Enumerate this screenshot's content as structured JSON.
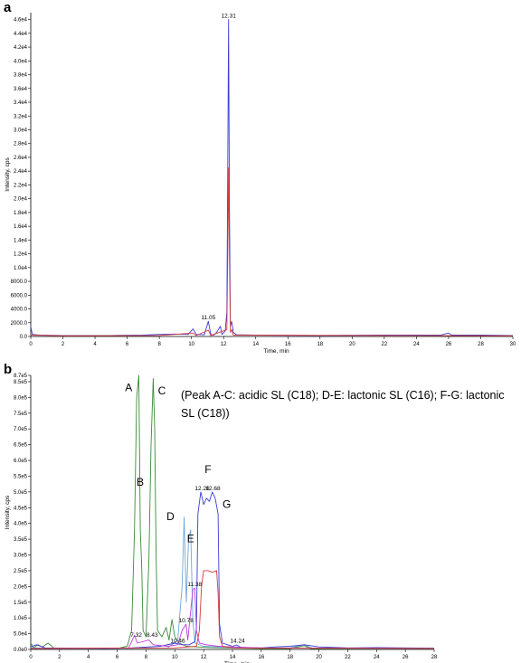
{
  "chart_data": [
    {
      "panel": "a",
      "type": "line",
      "xlabel": "Time, min",
      "ylabel": "Intensity, cps",
      "xlim": [
        0,
        30
      ],
      "ylim": [
        0,
        47000
      ],
      "x_ticks": [
        "0",
        "2",
        "4",
        "6",
        "8",
        "10",
        "12",
        "14",
        "16",
        "18",
        "20",
        "22",
        "24",
        "26",
        "28",
        "30"
      ],
      "y_ticks": [
        {
          "v": 0,
          "t": "0.0"
        },
        {
          "v": 2000,
          "t": "2000.0"
        },
        {
          "v": 4000,
          "t": "4000.0"
        },
        {
          "v": 6000,
          "t": "6000.0"
        },
        {
          "v": 8000,
          "t": "8000.0"
        },
        {
          "v": 10000,
          "t": "1.0e4"
        },
        {
          "v": 12000,
          "t": "1.2e4"
        },
        {
          "v": 14000,
          "t": "1.4e4"
        },
        {
          "v": 16000,
          "t": "1.6e4"
        },
        {
          "v": 18000,
          "t": "1.8e4"
        },
        {
          "v": 20000,
          "t": "2.0e4"
        },
        {
          "v": 22000,
          "t": "2.2e4"
        },
        {
          "v": 24000,
          "t": "2.4e4"
        },
        {
          "v": 26000,
          "t": "2.6e4"
        },
        {
          "v": 28000,
          "t": "2.8e4"
        },
        {
          "v": 30000,
          "t": "3.0e4"
        },
        {
          "v": 32000,
          "t": "3.2e4"
        },
        {
          "v": 34000,
          "t": "3.4e4"
        },
        {
          "v": 36000,
          "t": "3.6e4"
        },
        {
          "v": 38000,
          "t": "3.8e4"
        },
        {
          "v": 40000,
          "t": "4.0e4"
        },
        {
          "v": 42000,
          "t": "4.2e4"
        },
        {
          "v": 44000,
          "t": "4.4e4"
        },
        {
          "v": 46000,
          "t": "4.6e4"
        }
      ],
      "peak_labels": [
        {
          "text": "12.31",
          "x": 12.31,
          "y": 46000
        },
        {
          "text": "11.05",
          "x": 11.05,
          "y": 2200
        }
      ],
      "series": [
        {
          "color": "#3b3bd6",
          "points": [
            [
              0,
              1400
            ],
            [
              0.1,
              300
            ],
            [
              0.5,
              200
            ],
            [
              2,
              150
            ],
            [
              5,
              150
            ],
            [
              7,
              200
            ],
            [
              8,
              300
            ],
            [
              9,
              350
            ],
            [
              9.8,
              300
            ],
            [
              10.1,
              1100
            ],
            [
              10.3,
              300
            ],
            [
              10.8,
              250
            ],
            [
              11.05,
              2200
            ],
            [
              11.2,
              300
            ],
            [
              11.4,
              200
            ],
            [
              11.6,
              700
            ],
            [
              11.8,
              1500
            ],
            [
              11.9,
              300
            ],
            [
              12.1,
              800
            ],
            [
              12.2,
              3500
            ],
            [
              12.25,
              20000
            ],
            [
              12.31,
              46000
            ],
            [
              12.36,
              20000
            ],
            [
              12.42,
              1500
            ],
            [
              12.5,
              2200
            ],
            [
              12.6,
              600
            ],
            [
              12.8,
              250
            ],
            [
              14,
              200
            ],
            [
              18,
              150
            ],
            [
              22,
              200
            ],
            [
              25.5,
              200
            ],
            [
              26,
              500
            ],
            [
              26.2,
              200
            ],
            [
              28,
              200
            ],
            [
              30,
              150
            ]
          ]
        },
        {
          "color": "#d63b3b",
          "points": [
            [
              0,
              200
            ],
            [
              2,
              100
            ],
            [
              8,
              150
            ],
            [
              10.1,
              500
            ],
            [
              10.3,
              150
            ],
            [
              11.05,
              900
            ],
            [
              11.2,
              150
            ],
            [
              12.2,
              1000
            ],
            [
              12.26,
              12000
            ],
            [
              12.31,
              24500
            ],
            [
              12.36,
              12000
            ],
            [
              12.42,
              600
            ],
            [
              12.5,
              1000
            ],
            [
              12.6,
              200
            ],
            [
              30,
              100
            ]
          ]
        }
      ]
    },
    {
      "panel": "b",
      "type": "line",
      "xlabel": "Time, min",
      "ylabel": "Intensity, cps",
      "xlim": [
        0,
        28
      ],
      "ylim": [
        0,
        870000
      ],
      "x_ticks": [
        "0",
        "2",
        "4",
        "6",
        "8",
        "10",
        "12",
        "14",
        "16",
        "18",
        "20",
        "22",
        "24",
        "26",
        "28"
      ],
      "y_ticks": [
        {
          "v": 0,
          "t": "0.0e0"
        },
        {
          "v": 50000,
          "t": "5.0e4"
        },
        {
          "v": 100000,
          "t": "1.0e5"
        },
        {
          "v": 150000,
          "t": "1.5e5"
        },
        {
          "v": 200000,
          "t": "2.0e5"
        },
        {
          "v": 250000,
          "t": "2.5e5"
        },
        {
          "v": 300000,
          "t": "3.0e5"
        },
        {
          "v": 350000,
          "t": "3.5e5"
        },
        {
          "v": 400000,
          "t": "4.0e5"
        },
        {
          "v": 450000,
          "t": "4.5e5"
        },
        {
          "v": 500000,
          "t": "5.0e5"
        },
        {
          "v": 550000,
          "t": "5.5e5"
        },
        {
          "v": 600000,
          "t": "6.0e5"
        },
        {
          "v": 650000,
          "t": "6.5e5"
        },
        {
          "v": 700000,
          "t": "7.0e5"
        },
        {
          "v": 750000,
          "t": "7.5e5"
        },
        {
          "v": 800000,
          "t": "8.0e5"
        },
        {
          "v": 850000,
          "t": "8.5e5"
        },
        {
          "v": 870000,
          "t": "8.7e5"
        }
      ],
      "peak_labels": [
        {
          "text": "7.32",
          "x": 7.32,
          "y": 35000
        },
        {
          "text": "8.43",
          "x": 8.43,
          "y": 35000
        },
        {
          "text": "10.46",
          "x": 10.2,
          "y": 16000
        },
        {
          "text": "10.78",
          "x": 10.78,
          "y": 80000
        },
        {
          "text": "11.38",
          "x": 11.38,
          "y": 195000
        },
        {
          "text": "12.26",
          "x": 11.9,
          "y": 500000
        },
        {
          "text": "12.68",
          "x": 12.65,
          "y": 500000
        },
        {
          "text": "14.24",
          "x": 14.35,
          "y": 16000
        }
      ],
      "peak_letters": [
        {
          "text": "A",
          "x": 6.8,
          "y": 820000
        },
        {
          "text": "B",
          "x": 7.6,
          "y": 520000
        },
        {
          "text": "C",
          "x": 9.1,
          "y": 810000
        },
        {
          "text": "D",
          "x": 9.7,
          "y": 410000
        },
        {
          "text": "E",
          "x": 11.1,
          "y": 340000
        },
        {
          "text": "F",
          "x": 12.3,
          "y": 560000
        },
        {
          "text": "G",
          "x": 13.6,
          "y": 450000
        }
      ],
      "annotation": [
        "(Peak A-C: acidic SL (C18); D-E: lactonic SL (C16); F-G: lactonic",
        "SL (C18))"
      ],
      "series": [
        {
          "color": "#3a8a3a",
          "points": [
            [
              0,
              20000
            ],
            [
              0.2,
              5000
            ],
            [
              0.5,
              15000
            ],
            [
              0.8,
              8000
            ],
            [
              1.2,
              20000
            ],
            [
              1.6,
              5000
            ],
            [
              2.2,
              3000
            ],
            [
              4,
              2000
            ],
            [
              6,
              3000
            ],
            [
              6.7,
              10000
            ],
            [
              7.0,
              60000
            ],
            [
              7.2,
              380000
            ],
            [
              7.35,
              800000
            ],
            [
              7.5,
              870000
            ],
            [
              7.6,
              380000
            ],
            [
              7.7,
              260000
            ],
            [
              7.8,
              60000
            ],
            [
              8.0,
              40000
            ],
            [
              8.2,
              280000
            ],
            [
              8.35,
              650000
            ],
            [
              8.5,
              860000
            ],
            [
              8.6,
              700000
            ],
            [
              8.7,
              300000
            ],
            [
              8.8,
              60000
            ],
            [
              9.1,
              40000
            ],
            [
              9.4,
              70000
            ],
            [
              9.6,
              30000
            ],
            [
              9.8,
              95000
            ],
            [
              10.0,
              40000
            ],
            [
              10.3,
              20000
            ],
            [
              10.8,
              10000
            ],
            [
              11.5,
              8000
            ],
            [
              12.5,
              6000
            ],
            [
              14,
              5000
            ],
            [
              16,
              3000
            ],
            [
              18,
              3000
            ],
            [
              19,
              12000
            ],
            [
              19.4,
              3000
            ],
            [
              22,
              2000
            ],
            [
              28,
              2000
            ]
          ]
        },
        {
          "color": "#6fa6d6",
          "points": [
            [
              0,
              5000
            ],
            [
              6,
              3000
            ],
            [
              9.5,
              5000
            ],
            [
              10.2,
              30000
            ],
            [
              10.5,
              200000
            ],
            [
              10.65,
              420000
            ],
            [
              10.8,
              150000
            ],
            [
              10.95,
              350000
            ],
            [
              11.1,
              380000
            ],
            [
              11.25,
              90000
            ],
            [
              11.4,
              20000
            ],
            [
              12,
              10000
            ],
            [
              13,
              8000
            ],
            [
              15,
              5000
            ],
            [
              18,
              5000
            ],
            [
              19,
              15000
            ],
            [
              19.5,
              5000
            ],
            [
              28,
              3000
            ]
          ]
        },
        {
          "color": "#3b3bd6",
          "points": [
            [
              0,
              8000
            ],
            [
              0.4,
              15000
            ],
            [
              1,
              5000
            ],
            [
              2,
              4000
            ],
            [
              5,
              3000
            ],
            [
              7,
              5000
            ],
            [
              9,
              10000
            ],
            [
              10,
              20000
            ],
            [
              10.5,
              15000
            ],
            [
              11,
              15000
            ],
            [
              11.4,
              25000
            ],
            [
              11.5,
              70000
            ],
            [
              11.6,
              430000
            ],
            [
              11.8,
              500000
            ],
            [
              12.0,
              460000
            ],
            [
              12.2,
              480000
            ],
            [
              12.4,
              470000
            ],
            [
              12.6,
              500000
            ],
            [
              12.8,
              480000
            ],
            [
              13.0,
              430000
            ],
            [
              13.1,
              80000
            ],
            [
              13.3,
              20000
            ],
            [
              14,
              10000
            ],
            [
              14.3,
              14000
            ],
            [
              14.6,
              6000
            ],
            [
              16,
              5000
            ],
            [
              17,
              8000
            ],
            [
              18,
              10000
            ],
            [
              19,
              15000
            ],
            [
              20,
              8000
            ],
            [
              22,
              5000
            ],
            [
              24,
              6000
            ],
            [
              26,
              5000
            ],
            [
              28,
              4000
            ]
          ]
        },
        {
          "color": "#c03be0",
          "points": [
            [
              0,
              3000
            ],
            [
              6.8,
              5000
            ],
            [
              7.2,
              45000
            ],
            [
              7.4,
              20000
            ],
            [
              8.2,
              30000
            ],
            [
              8.5,
              15000
            ],
            [
              9.5,
              10000
            ],
            [
              10.2,
              15000
            ],
            [
              10.5,
              60000
            ],
            [
              10.78,
              80000
            ],
            [
              10.9,
              30000
            ],
            [
              11.1,
              120000
            ],
            [
              11.25,
              190000
            ],
            [
              11.38,
              195000
            ],
            [
              11.5,
              60000
            ],
            [
              11.7,
              20000
            ],
            [
              12.2,
              15000
            ],
            [
              13,
              10000
            ],
            [
              14,
              8000
            ],
            [
              16,
              5000
            ],
            [
              28,
              3000
            ]
          ]
        },
        {
          "color": "#d63b3b",
          "points": [
            [
              0,
              3000
            ],
            [
              10,
              5000
            ],
            [
              11.5,
              10000
            ],
            [
              11.7,
              60000
            ],
            [
              11.85,
              200000
            ],
            [
              12.0,
              250000
            ],
            [
              12.3,
              250000
            ],
            [
              12.6,
              245000
            ],
            [
              12.9,
              250000
            ],
            [
              13.0,
              180000
            ],
            [
              13.1,
              40000
            ],
            [
              13.3,
              10000
            ],
            [
              14,
              5000
            ],
            [
              28,
              3000
            ]
          ]
        }
      ]
    }
  ]
}
